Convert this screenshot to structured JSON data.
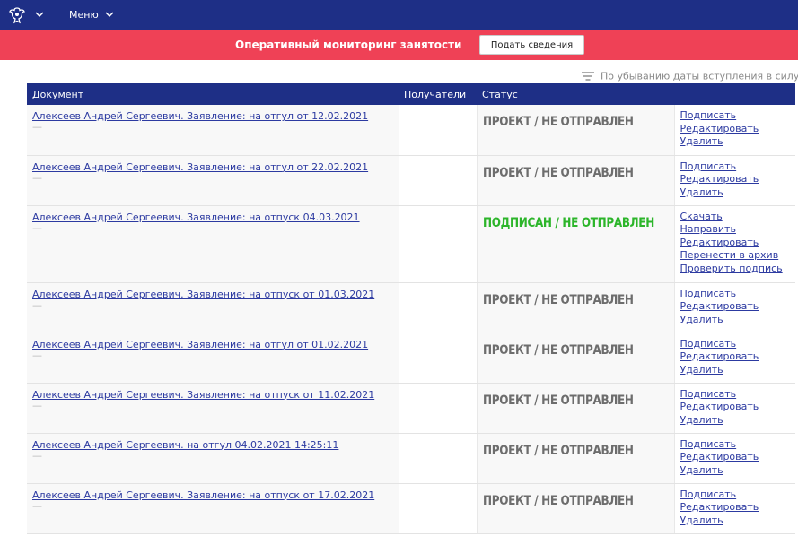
{
  "header": {
    "menu_label": "Меню"
  },
  "banner": {
    "title": "Оперативный мониторинг занятости",
    "submit_button": "Подать сведения"
  },
  "sort": {
    "label": "По убыванию даты вступления в силу"
  },
  "table": {
    "columns": {
      "document": "Документ",
      "recipients": "Получатели",
      "status": "Статус"
    },
    "rows": [
      {
        "doc": "Алексеев Андрей Сергеевич. Заявление: на отгул от 12.02.2021",
        "sub": "—",
        "status": "ПРОЕКТ / НЕ ОТПРАВЛЕН",
        "status_color": "#6d6d6d",
        "actions": [
          "Подписать",
          "Редактировать",
          "Удалить"
        ]
      },
      {
        "doc": "Алексеев Андрей Сергеевич. Заявление: на отгул от 22.02.2021",
        "sub": "—",
        "status": "ПРОЕКТ / НЕ ОТПРАВЛЕН",
        "status_color": "#6d6d6d",
        "actions": [
          "Подписать",
          "Редактировать",
          "Удалить"
        ]
      },
      {
        "doc": "Алексеев Андрей Сергеевич. Заявление: на отпуск 04.03.2021",
        "sub": "—",
        "status": "ПОДПИСАН / НЕ ОТПРАВЛЕН",
        "status_color": "#2cb52a",
        "actions": [
          "Скачать",
          "Направить",
          "Редактировать",
          "Перенести в архив",
          "Проверить подпись"
        ]
      },
      {
        "doc": "Алексеев Андрей Сергеевич. Заявление: на отпуск от 01.03.2021",
        "sub": "—",
        "status": "ПРОЕКТ / НЕ ОТПРАВЛЕН",
        "status_color": "#6d6d6d",
        "actions": [
          "Подписать",
          "Редактировать",
          "Удалить"
        ]
      },
      {
        "doc": "Алексеев Андрей Сергеевич. Заявление: на отгул от 01.02.2021",
        "sub": "—",
        "status": "ПРОЕКТ / НЕ ОТПРАВЛЕН",
        "status_color": "#6d6d6d",
        "actions": [
          "Подписать",
          "Редактировать",
          "Удалить"
        ]
      },
      {
        "doc": "Алексеев Андрей Сергеевич. Заявление: на отпуск от 11.02.2021",
        "sub": "—",
        "status": "ПРОЕКТ / НЕ ОТПРАВЛЕН",
        "status_color": "#6d6d6d",
        "actions": [
          "Подписать",
          "Редактировать",
          "Удалить"
        ]
      },
      {
        "doc": "Алексеев Андрей Сергеевич. на отгул 04.02.2021 14:25:11",
        "sub": "—",
        "status": "ПРОЕКТ / НЕ ОТПРАВЛЕН",
        "status_color": "#6d6d6d",
        "actions": [
          "Подписать",
          "Редактировать",
          "Удалить"
        ]
      },
      {
        "doc": "Алексеев Андрей Сергеевич. Заявление: на отпуск от 17.02.2021",
        "sub": "—",
        "status": "ПРОЕКТ / НЕ ОТПРАВЛЕН",
        "status_color": "#6d6d6d",
        "actions": [
          "Подписать",
          "Редактировать",
          "Удалить"
        ]
      }
    ]
  }
}
